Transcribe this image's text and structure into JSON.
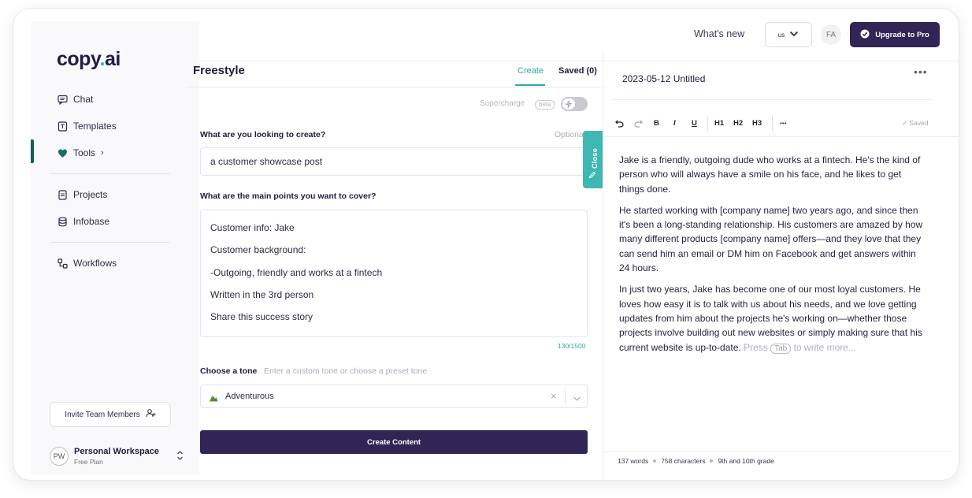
{
  "app": {
    "logo_text_1": "copy",
    "logo_dot": ".",
    "logo_text_2": "ai"
  },
  "sidebar": {
    "items": [
      {
        "label": "Chat",
        "icon": "chat-icon"
      },
      {
        "label": "Templates",
        "icon": "templates-icon"
      },
      {
        "label": "Tools",
        "icon": "tools-icon"
      },
      {
        "label": "Projects",
        "icon": "projects-icon"
      },
      {
        "label": "Infobase",
        "icon": "infobase-icon"
      },
      {
        "label": "Workflows",
        "icon": "workflows-icon"
      }
    ],
    "tools_chevron": "›",
    "invite_label": "Invite Team Members",
    "workspace": {
      "initials": "PW",
      "name": "Personal Workspace",
      "plan": "Free Plan"
    }
  },
  "topbar": {
    "whats_new": "What's new",
    "locale": "us",
    "user_initials": "FA",
    "upgrade_label": "Upgrade to Pro"
  },
  "editor": {
    "title": "Freestyle",
    "tabs": {
      "create": "Create",
      "saved": "Saved (0)"
    },
    "supercharge_label": "Supercharge",
    "beta_label": "beta",
    "field1_label": "What are you looking to create?",
    "field1_optional": "Optional",
    "field1_value": "a customer showcase post",
    "field2_label": "What are the main points you want to cover?",
    "field2_lines": [
      "Customer info: Jake",
      "Customer background:",
      "-Outgoing, friendly and works at a fintech",
      "Written in the 3rd person",
      "Share this success story"
    ],
    "char_counter": "130/1500",
    "tone_label": "Choose a tone",
    "tone_hint": "Enter a custom tone or choose a preset tone",
    "tone_value": "Adventurous",
    "create_button": "Create Content",
    "close_tab": "Close"
  },
  "document": {
    "title": "2023-05-12 Untitled",
    "toolbar": {
      "bold": "B",
      "italic": "I",
      "underline": "U",
      "h1": "H1",
      "h2": "H2",
      "h3": "H3",
      "more": "•••",
      "saved": "Saved"
    },
    "paragraphs": [
      "Jake is a friendly, outgoing dude who works at a fintech. He's the kind of person who will always have a smile on his face, and he likes to get things done.",
      "He started working with [company name] two years ago, and since then it's been a long-standing relationship. His customers are amazed by how many different products [company name] offers—and they love that they can send him an email or DM him on Facebook and get answers within 24 hours.",
      "In just two years, Jake has become one of our most loyal customers. He loves how easy it is to talk with us about his needs, and we love getting updates from him about the projects he's working on—whether those projects involve building out new websites or simply making sure that his current website is up-to-date."
    ],
    "hint_press": "Press",
    "hint_key": "Tab",
    "hint_rest": "to write more...",
    "stats": {
      "words": "137 words",
      "characters": "758 characters",
      "grade": "9th and 10th grade"
    }
  },
  "colors": {
    "brand_dark": "#302555",
    "accent_teal": "#2aa7a5",
    "text_primary": "#1f1c3d"
  }
}
